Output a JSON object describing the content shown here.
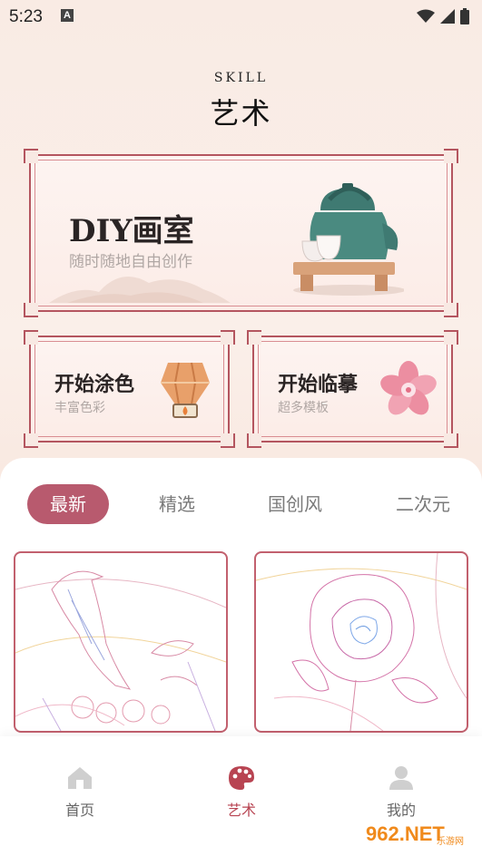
{
  "status_bar": {
    "time": "5:23",
    "notification_icon": "A"
  },
  "header": {
    "eyebrow": "SKILL",
    "title": "艺术"
  },
  "banner": {
    "title": "DIY画室",
    "subtitle": "随时随地自由创作"
  },
  "cards": [
    {
      "title": "开始涂色",
      "subtitle": "丰富色彩"
    },
    {
      "title": "开始临摹",
      "subtitle": "超多模板"
    }
  ],
  "tabs": [
    "最新",
    "精选",
    "国创风",
    "二次元"
  ],
  "active_tab": "最新",
  "bottom_nav": [
    {
      "label": "首页",
      "icon": "home-icon"
    },
    {
      "label": "艺术",
      "icon": "palette-icon"
    },
    {
      "label": "我的",
      "icon": "person-icon"
    }
  ],
  "watermark": {
    "text": "962.NET",
    "sub": "乐游网"
  },
  "colors": {
    "accent": "#b85a6e",
    "frame": "#b4555f",
    "nav_active": "#b84452"
  }
}
